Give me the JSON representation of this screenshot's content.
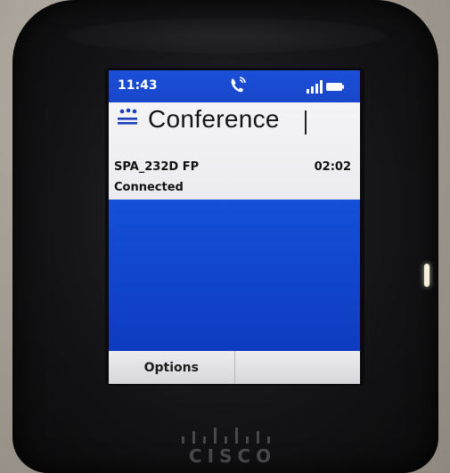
{
  "status_bar": {
    "time": "11:43",
    "call_icon": "phone-ringing-icon",
    "signal_icon": "signal-bars-icon",
    "battery_icon": "battery-icon"
  },
  "header": {
    "conference_icon": "conference-icon",
    "title": "Conference"
  },
  "call": {
    "caller": "SPA_232D FP",
    "duration": "02:02",
    "status": "Connected"
  },
  "softkeys": [
    {
      "label": "Options"
    },
    {
      "label": ""
    }
  ],
  "brand": {
    "logo_icon": "cisco-logo-icon",
    "name": "CISCO"
  },
  "colors": {
    "screen_blue": "#0f3fcf",
    "panel_white": "#f4f4f6",
    "phone_body": "#141416"
  }
}
